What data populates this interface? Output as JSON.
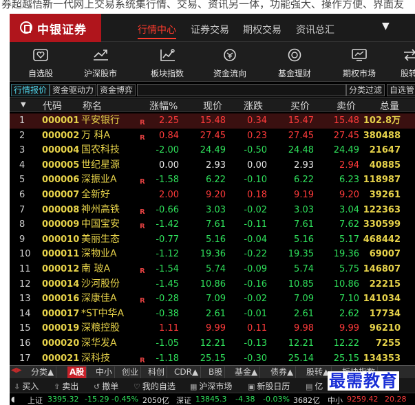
{
  "background_text": "券超越悟新一代网上交易系统集行情、交易、资讯另一体，功能强大、操作方便、界面友",
  "header": {
    "logo_text": "中银证券",
    "nav": [
      "行情中心",
      "证券交易",
      "期权交易",
      "资讯总汇"
    ],
    "active_nav": "行情中心",
    "menu_glyph": "▼"
  },
  "toolbar": [
    {
      "label": "自选股",
      "icon": "heart-box-icon"
    },
    {
      "label": "沪深股市",
      "icon": "trend-line-icon"
    },
    {
      "label": "板块指数",
      "icon": "chart-line-icon"
    },
    {
      "label": "资金流向",
      "icon": "money-flow-icon"
    },
    {
      "label": "基金理财",
      "icon": "fund-coin-icon"
    },
    {
      "label": "期权市场",
      "icon": "monitor-chart-icon"
    },
    {
      "label": "股转",
      "icon": "transfer-icon"
    }
  ],
  "subtabs": {
    "left": [
      "行情报价",
      "资金驱动力",
      "资金博弈"
    ],
    "right": [
      "分类过滤",
      "自选管"
    ]
  },
  "table": {
    "headers": {
      "code": "代码",
      "name": "称名",
      "change_pct": "涨幅%",
      "price": "现价",
      "change": "涨跌",
      "bid": "买价",
      "ask": "卖价",
      "volume": "总量"
    },
    "rows": [
      {
        "idx": "1",
        "code": "000001",
        "name": "平安银行",
        "flag": "R",
        "pct": "2.25",
        "price": "15.48",
        "chg": "0.34",
        "bid": "15.47",
        "ask": "15.48",
        "vol": "102.8万",
        "dir": "up"
      },
      {
        "idx": "2",
        "code": "000002",
        "name": "万 科A",
        "flag": "R",
        "pct": "0.84",
        "price": "27.45",
        "chg": "0.23",
        "bid": "27.45",
        "ask": "27.45",
        "vol": "380488",
        "dir": "up"
      },
      {
        "idx": "3",
        "code": "000004",
        "name": "国农科技",
        "flag": "",
        "pct": "-2.00",
        "price": "24.49",
        "chg": "-0.50",
        "bid": "24.48",
        "ask": "24.49",
        "vol": "21647",
        "dir": "down"
      },
      {
        "idx": "4",
        "code": "000005",
        "name": "世纪星源",
        "flag": "",
        "pct": "0.00",
        "price": "2.93",
        "chg": "0.00",
        "bid": "2.93",
        "ask": "2.94",
        "vol": "40885",
        "dir": "flat"
      },
      {
        "idx": "5",
        "code": "000006",
        "name": "深振业A",
        "flag": "R",
        "pct": "-1.58",
        "price": "6.22",
        "chg": "-0.10",
        "bid": "6.22",
        "ask": "6.23",
        "vol": "118987",
        "dir": "down"
      },
      {
        "idx": "6",
        "code": "000007",
        "name": "全新好",
        "flag": "",
        "pct": "2.00",
        "price": "9.20",
        "chg": "0.18",
        "bid": "9.19",
        "ask": "9.20",
        "vol": "39261",
        "dir": "up"
      },
      {
        "idx": "7",
        "code": "000008",
        "name": "神州高铁",
        "flag": "R",
        "pct": "-0.66",
        "price": "3.03",
        "chg": "-0.02",
        "bid": "3.03",
        "ask": "3.04",
        "vol": "122363",
        "dir": "down"
      },
      {
        "idx": "8",
        "code": "000009",
        "name": "中国宝安",
        "flag": "R",
        "pct": "-1.42",
        "price": "7.61",
        "chg": "-0.11",
        "bid": "7.61",
        "ask": "7.62",
        "vol": "330599",
        "dir": "down"
      },
      {
        "idx": "9",
        "code": "000010",
        "name": "美丽生态",
        "flag": "",
        "pct": "-0.77",
        "price": "5.16",
        "chg": "-0.04",
        "bid": "5.16",
        "ask": "5.17",
        "vol": "468442",
        "dir": "down"
      },
      {
        "idx": "10",
        "code": "000011",
        "name": "深物业A",
        "flag": "",
        "pct": "-1.12",
        "price": "19.36",
        "chg": "-0.22",
        "bid": "19.35",
        "ask": "19.36",
        "vol": "69007",
        "dir": "down"
      },
      {
        "idx": "11",
        "code": "000012",
        "name": "南 玻A",
        "flag": "R",
        "pct": "-1.54",
        "price": "5.74",
        "chg": "-0.09",
        "bid": "5.74",
        "ask": "5.75",
        "vol": "146807",
        "dir": "down"
      },
      {
        "idx": "12",
        "code": "000014",
        "name": "沙河股份",
        "flag": "",
        "pct": "-1.45",
        "price": "10.86",
        "chg": "-0.16",
        "bid": "10.85",
        "ask": "10.86",
        "vol": "22215",
        "dir": "down"
      },
      {
        "idx": "13",
        "code": "000016",
        "name": "深康佳A",
        "flag": "R",
        "pct": "-0.28",
        "price": "7.09",
        "chg": "-0.02",
        "bid": "7.09",
        "ask": "7.10",
        "vol": "141034",
        "dir": "down"
      },
      {
        "idx": "14",
        "code": "000017",
        "name": "*ST中华A",
        "flag": "",
        "pct": "-0.38",
        "price": "2.61",
        "chg": "-0.01",
        "bid": "2.61",
        "ask": "2.62",
        "vol": "17734",
        "dir": "down"
      },
      {
        "idx": "15",
        "code": "000019",
        "name": "深粮控股",
        "flag": "",
        "pct": "1.11",
        "price": "9.99",
        "chg": "0.11",
        "bid": "9.98",
        "ask": "9.99",
        "vol": "96210",
        "dir": "up"
      },
      {
        "idx": "16",
        "code": "000020",
        "name": "深华发A",
        "flag": "",
        "pct": "-1.05",
        "price": "12.21",
        "chg": "-0.13",
        "bid": "12.21",
        "ask": "12.22",
        "vol": "7255",
        "dir": "down"
      },
      {
        "idx": "17",
        "code": "000021",
        "name": "深科技",
        "flag": "R",
        "pct": "-1.18",
        "price": "25.15",
        "chg": "-0.30",
        "bid": "25.14",
        "ask": "25.15",
        "vol": "134353",
        "dir": "down"
      }
    ]
  },
  "bottom_tabs": [
    "分类▲",
    "A股",
    "中小",
    "创业",
    "科创",
    "CDR▲",
    "B股",
    "基金▲",
    "债券▲",
    "股转▲",
    "板块指数"
  ],
  "bottom_active": "A股",
  "actions": [
    {
      "label": "买入",
      "icon": "buy-icon"
    },
    {
      "label": "卖出",
      "icon": "sell-icon"
    },
    {
      "label": "撤单",
      "icon": "cancel-order-icon"
    },
    {
      "label": "我的自选",
      "icon": "favorites-icon"
    },
    {
      "label": "沪深市场",
      "icon": "market-icon"
    },
    {
      "label": "新股日历",
      "icon": "calendar-icon"
    },
    {
      "label": "亿",
      "icon": "more-icon"
    }
  ],
  "status": {
    "sh_label": "上证",
    "sh_value": "3395.32",
    "sh_change": "-15.29",
    "sh_pct": "-0.45%",
    "sh_amount": "2050亿",
    "sz_label": "深证",
    "sz_value": "13845.3",
    "sz_change": "-4.38",
    "sz_pct": "-0.03%",
    "sz_amount": "3682亿",
    "zx_label": "中小",
    "zx_value": "9259.42",
    "zx_change": "20.28"
  },
  "watermark": "最需教育",
  "colors": {
    "brand": "#b0151c",
    "up": "#ff3b3b",
    "down": "#2fe05b",
    "code": "#e6d24a",
    "active_tab": "#4fd9f0"
  }
}
